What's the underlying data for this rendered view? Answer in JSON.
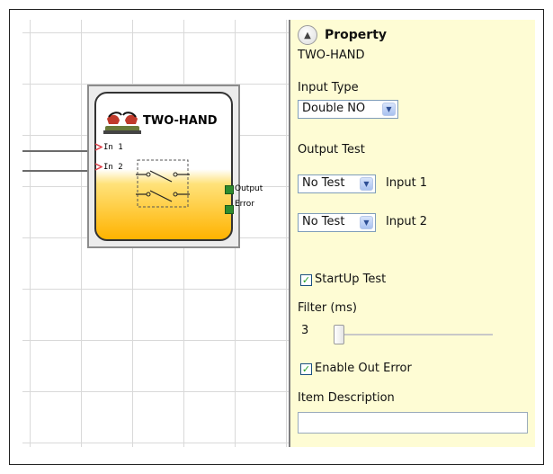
{
  "block": {
    "title": "TWO-HAND",
    "inputs": [
      "In 1",
      "In 2"
    ],
    "outputs": [
      "Output",
      "Error"
    ]
  },
  "property": {
    "header": "Property",
    "block_name": "TWO-HAND",
    "input_type_label": "Input Type",
    "input_type_value": "Double NO",
    "output_test_label": "Output Test",
    "output_tests": [
      {
        "value": "No Test",
        "label": "Input 1"
      },
      {
        "value": "No Test",
        "label": "Input 2"
      }
    ],
    "startup_test_label": "StartUp Test",
    "startup_test_checked": true,
    "filter_label": "Filter (ms)",
    "filter_value": "3",
    "enable_out_error_label": "Enable Out Error",
    "enable_out_error_checked": true,
    "item_description_label": "Item Description",
    "item_description_value": ""
  },
  "colors": {
    "panel_bg": "#fefcd4",
    "block_gradient_bottom": "#ffb300",
    "port_green": "#2e8b2e",
    "input_arrow": "#e0404a"
  }
}
